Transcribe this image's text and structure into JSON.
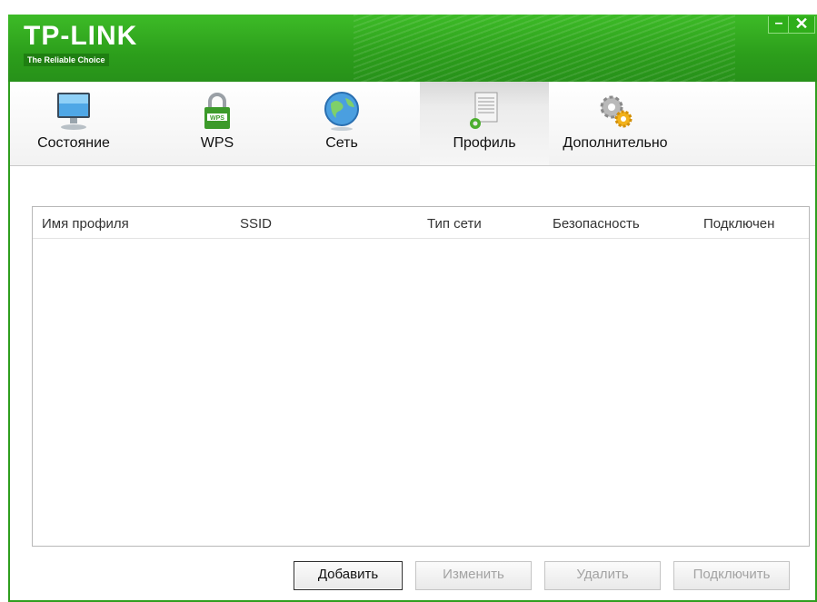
{
  "window": {
    "logo": "TP-LINK",
    "tagline": "The Reliable Choice",
    "minimize_glyph": "–",
    "close_glyph": "✕"
  },
  "tabs": [
    {
      "label": "Состояние",
      "icon": "monitor-icon",
      "active": false
    },
    {
      "label": "WPS",
      "icon": "wps-lock-icon",
      "active": false
    },
    {
      "label": "Сеть",
      "icon": "globe-icon",
      "active": false
    },
    {
      "label": "Профиль",
      "icon": "profile-document-icon",
      "active": true
    },
    {
      "label": "Дополнительно",
      "icon": "gears-icon",
      "active": false
    }
  ],
  "profiles_table": {
    "columns": [
      "Имя профиля",
      "SSID",
      "Тип сети",
      "Безопасность",
      "Подключен"
    ],
    "rows": []
  },
  "buttons": {
    "add": "Добавить",
    "edit": "Изменить",
    "delete": "Удалить",
    "connect": "Подключить"
  },
  "colors": {
    "brand_green": "#2f9e1e",
    "text": "#111111",
    "disabled_text": "#a3a3a3"
  }
}
